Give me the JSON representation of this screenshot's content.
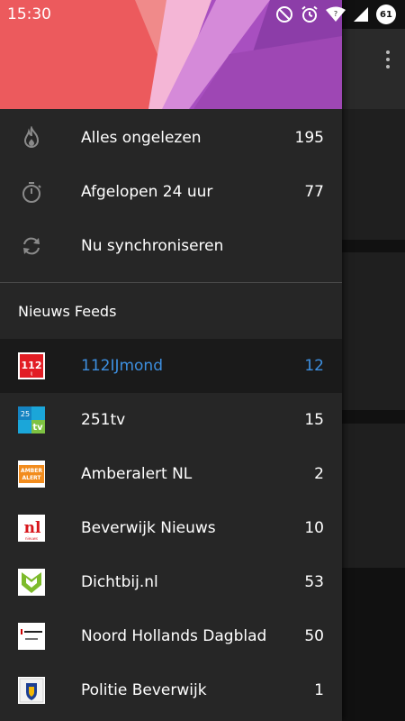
{
  "status_bar": {
    "time": "15:30",
    "icons": [
      "do-not-disturb-icon",
      "alarm-icon",
      "wifi-icon",
      "signal-icon"
    ],
    "battery": "61"
  },
  "menu": [
    {
      "label": "Alles ongelezen",
      "count": "195",
      "icon": "flame-icon"
    },
    {
      "label": "Afgelopen 24 uur",
      "count": "77",
      "icon": "stopwatch-icon"
    },
    {
      "label": "Nu synchroniseren",
      "count": "",
      "icon": "sync-icon"
    }
  ],
  "section_title": "Nieuws Feeds",
  "feeds": [
    {
      "label": "112IJmond",
      "count": "12",
      "active": true,
      "icon": "112-logo-icon"
    },
    {
      "label": "251tv",
      "count": "15",
      "active": false,
      "icon": "251tv-logo-icon"
    },
    {
      "label": "Amberalert NL",
      "count": "2",
      "active": false,
      "icon": "amber-alert-logo-icon"
    },
    {
      "label": "Beverwijk Nieuws",
      "count": "10",
      "active": false,
      "icon": "nieuws-nl-logo-icon"
    },
    {
      "label": "Dichtbij.nl",
      "count": "53",
      "active": false,
      "icon": "dichtbij-logo-icon"
    },
    {
      "label": "Noord Hollands Dagblad",
      "count": "50",
      "active": false,
      "icon": "noordhollands-dagblad-logo-icon"
    },
    {
      "label": "Politie Beverwijk",
      "count": "1",
      "active": false,
      "icon": "politie-logo-icon"
    }
  ],
  "colors": {
    "accent": "#3d8fe0",
    "drawer_bg": "#262626",
    "active_bg": "#1a1a1a"
  }
}
